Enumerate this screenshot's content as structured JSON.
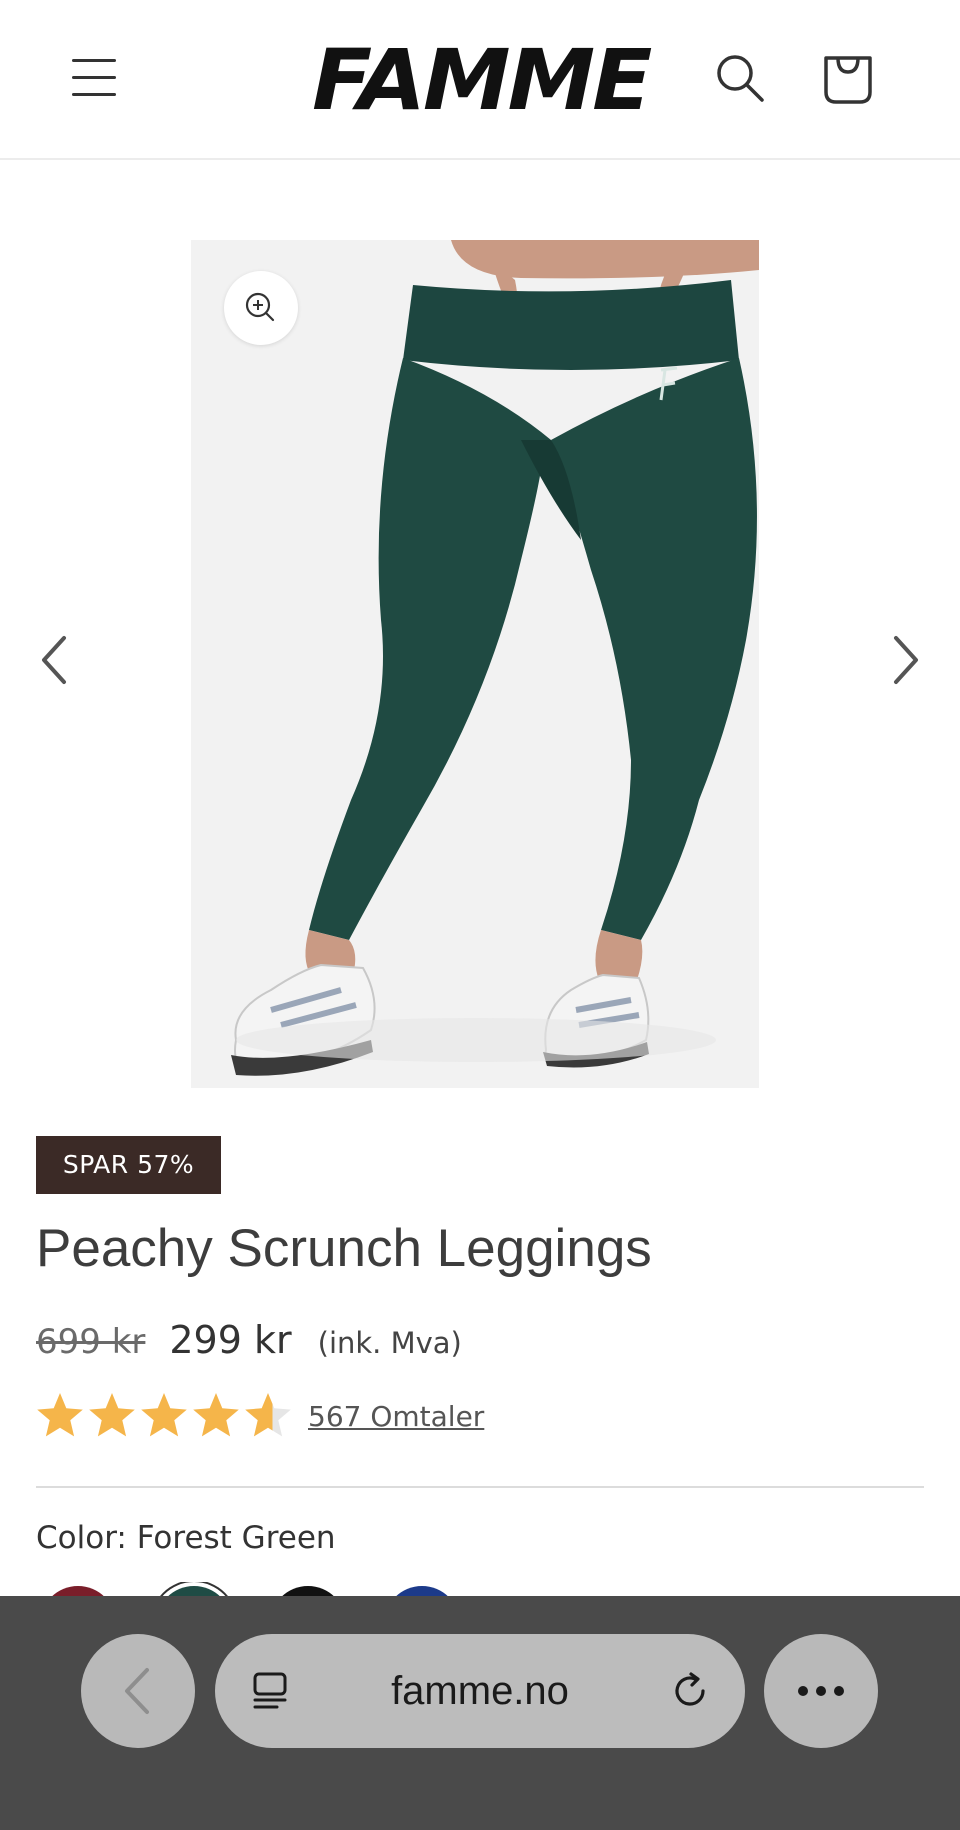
{
  "header": {
    "logo_text": "FAMME",
    "menu_icon": "hamburger-icon",
    "search_icon": "search-icon",
    "cart_icon": "shopping-bag-icon"
  },
  "gallery": {
    "image_alt": "Woman wearing forest green leggings and white sneakers",
    "zoom_icon": "zoom-in-icon",
    "prev_icon": "chevron-left-icon",
    "next_icon": "chevron-right-icon"
  },
  "product": {
    "badge": "SPAR 57%",
    "title": "Peachy Scrunch Leggings",
    "old_price": "699 kr",
    "price": "299 kr",
    "vat_note": "(ink. Mva)",
    "rating": 4.6,
    "rating_max": 5,
    "reviews_link": "567 Omtaler",
    "color_label": "Color: Forest Green",
    "swatches": [
      {
        "name": "burgundy",
        "color": "#7a1e2a"
      },
      {
        "name": "forest-green",
        "color": "#1f4c45",
        "selected": true
      },
      {
        "name": "black",
        "color": "#111111"
      },
      {
        "name": "royal-blue",
        "color": "#1c3a8a"
      }
    ]
  },
  "colors": {
    "badge_bg": "#3b2a26",
    "star": "#f5b54a",
    "star_empty": "#e6e6e6",
    "legging": "#1f4a42",
    "browser_bar": "#4a4a4a"
  },
  "browser": {
    "back_icon": "chevron-left-icon",
    "tabs_icon": "page-menu-icon",
    "url": "famme.no",
    "reload_icon": "reload-icon",
    "more_icon": "more-dots-icon"
  }
}
